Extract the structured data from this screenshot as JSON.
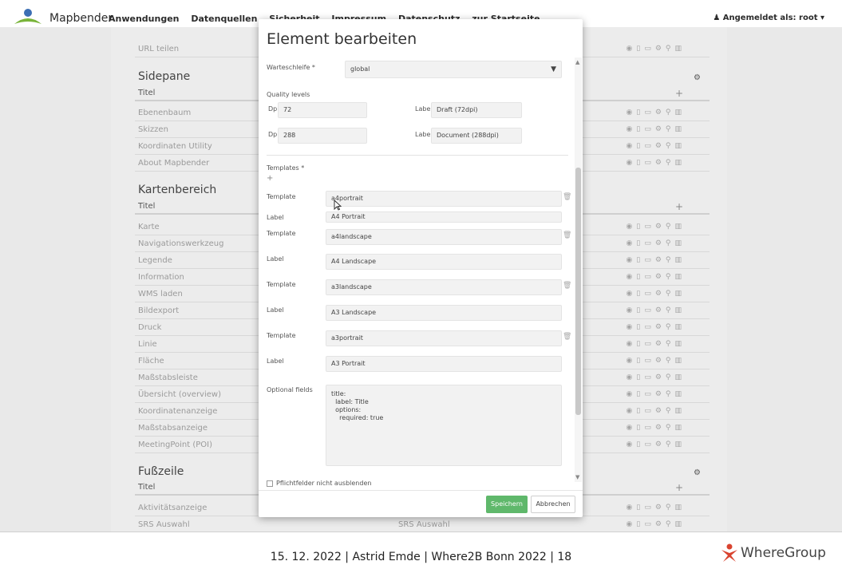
{
  "navbar": {
    "brand": "Mapbender",
    "links": [
      "Anwendungen",
      "Datenquellen",
      "Sicherheit",
      "Impressum",
      "Datenschutz",
      "zur Startseite"
    ],
    "user": "Angemeldet als: root"
  },
  "background": {
    "top_row": "URL teilen",
    "sections": [
      {
        "title": "Sidepane",
        "col_head": "Titel",
        "rows": [
          {
            "label": "Ebenenbaum",
            "mid": ""
          },
          {
            "label": "Skizzen",
            "mid": ""
          },
          {
            "label": "Koordinaten Utility",
            "mid": ""
          },
          {
            "label": "About Mapbender",
            "mid": ""
          }
        ]
      },
      {
        "title": "Kartenbereich",
        "col_head": "Titel",
        "rows": [
          {
            "label": "Karte",
            "mid": ""
          },
          {
            "label": "Navigationswerkzeug",
            "mid": ""
          },
          {
            "label": "Legende",
            "mid": ""
          },
          {
            "label": "Information",
            "mid": ""
          },
          {
            "label": "WMS laden",
            "mid": ""
          },
          {
            "label": "Bildexport",
            "mid": ""
          },
          {
            "label": "Druck",
            "mid": ""
          },
          {
            "label": "Linie",
            "mid": ""
          },
          {
            "label": "Fläche",
            "mid": ""
          },
          {
            "label": "Maßstabsleiste",
            "mid": ""
          },
          {
            "label": "Übersicht (overview)",
            "mid": ""
          },
          {
            "label": "Koordinatenanzeige",
            "mid": ""
          },
          {
            "label": "Maßstabsanzeige",
            "mid": ""
          },
          {
            "label": "MeetingPoint (POI)",
            "mid": ""
          }
        ]
      },
      {
        "title": "Fußzeile",
        "col_head": "Titel",
        "rows": [
          {
            "label": "Aktivitätsanzeige",
            "mid": ""
          },
          {
            "label": "SRS Auswahl",
            "mid": "SRS Auswahl"
          }
        ]
      }
    ]
  },
  "modal": {
    "title": "Element bearbeiten",
    "queue_label": "Warteschleife *",
    "queue_value": "global",
    "quality_label": "Quality levels",
    "quality": [
      {
        "dpi_label": "Dpi",
        "dpi": "72",
        "label_label": "Label",
        "label": "Draft (72dpi)"
      },
      {
        "dpi_label": "Dpi",
        "dpi": "288",
        "label_label": "Label",
        "label": "Document (288dpi)"
      }
    ],
    "templates_label": "Templates *",
    "templates": [
      {
        "template_label": "Template",
        "template": "a4portrait",
        "label_label": "Label",
        "label": "A4 Portrait"
      },
      {
        "template_label": "Template",
        "template": "a4landscape",
        "label_label": "Label",
        "label": "A4 Landscape"
      },
      {
        "template_label": "Template",
        "template": "a3landscape",
        "label_label": "Label",
        "label": "A3 Landscape"
      },
      {
        "template_label": "Template",
        "template": "a3portrait",
        "label_label": "Label",
        "label": "A3 Portrait"
      }
    ],
    "optional_label": "Optional fields",
    "optional_value": "title:\n  label: Title\n  options:\n    required: true",
    "checkbox_label": "Pflichtfelder nicht ausblenden",
    "save": "Speichern",
    "cancel": "Abbrechen"
  },
  "footer": {
    "caption": "15. 12. 2022 | Astrid Emde | Where2B Bonn 2022 | 18",
    "brand": "WhereGroup"
  },
  "colors": {
    "save_button": "#5fb86b",
    "logo_green": "#79b43a",
    "logo_blue": "#3c6fb4",
    "wheregroup_red": "#d9432f"
  }
}
